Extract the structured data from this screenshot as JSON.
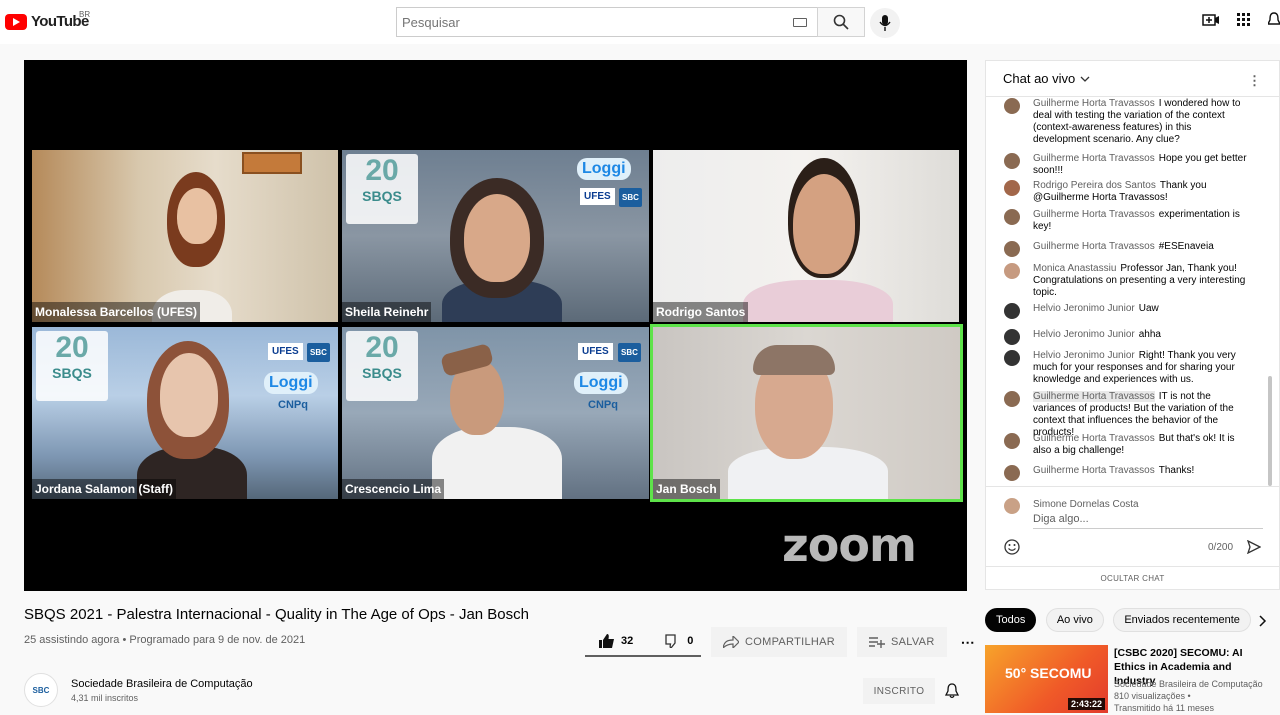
{
  "header": {
    "logo_text": "YouTube",
    "country": "BR",
    "search_placeholder": "Pesquisar"
  },
  "video": {
    "zoom_text": "zoom",
    "participants": [
      {
        "name": "Monalessa Barcellos (UFES)"
      },
      {
        "name": "Sheila Reinehr"
      },
      {
        "name": "Rodrigo Santos"
      },
      {
        "name": "Jordana Salamon (Staff)"
      },
      {
        "name": "Crescencio Lima"
      },
      {
        "name": "Jan Bosch"
      }
    ],
    "event_logo": "SBQS",
    "event_years": "20",
    "sponsor": "Loggi",
    "ufes": "UFES",
    "sbc": "SBC",
    "cnpq": "CNPq"
  },
  "info": {
    "title": "SBQS 2021 - Palestra Internacional - Quality in The Age of Ops - Jan Bosch",
    "meta": "25 assistindo agora • Programado para 9 de nov. de 2021",
    "likes": "32",
    "dislikes": "0",
    "share": "COMPARTILHAR",
    "save": "SALVAR",
    "channel": "Sociedade Brasileira de Computação",
    "subs": "4,31 mil inscritos",
    "subscribe": "INSCRITO"
  },
  "chat": {
    "title": "Chat ao vivo",
    "messages": [
      {
        "author": "Guilherme Horta Travassos",
        "text": "I wondered how to deal with testing the variation of the context (context-awareness features) in this development scenario. Any clue?"
      },
      {
        "author": "Guilherme Horta Travassos",
        "text": "Hope you get better soon!!!"
      },
      {
        "author": "Rodrigo Pereira dos Santos",
        "text": "Thank you @Guilherme Horta Travassos!"
      },
      {
        "author": "Guilherme Horta Travassos",
        "text": "experimentation is key!"
      },
      {
        "author": "Guilherme Horta Travassos",
        "text": "#ESEnaveia"
      },
      {
        "author": "Monica Anastassiu",
        "text": "Professor Jan, Thank you! Congratulations on presenting a very interesting topic."
      },
      {
        "author": "Helvio Jeronimo Junior",
        "text": "Uaw"
      },
      {
        "author": "Helvio Jeronimo Junior",
        "text": "ahha"
      },
      {
        "author": "Helvio Jeronimo Junior",
        "text": "Right! Thank you very much for your responses and for sharing your knowledge and experiences with us."
      },
      {
        "author": "Guilherme Horta Travassos",
        "text": "IT is not the variances of products! But the variation of the context that influences the behavior of the products!"
      },
      {
        "author": "Guilherme Horta Travassos",
        "text": "But that's ok! It is also a big challenge!"
      },
      {
        "author": "Guilherme Horta Travassos",
        "text": "Thanks!"
      }
    ],
    "input_user": "Simone Dornelas Costa",
    "input_placeholder": "Diga algo...",
    "counter": "0/200",
    "hide": "OCULTAR CHAT"
  },
  "chips": [
    "Todos",
    "Ao vivo",
    "Enviados recentemente"
  ],
  "related": {
    "title": "[CSBC 2020] SECOMU: AI Ethics in Academia and Industry",
    "channel": "Sociedade Brasileira de Computação",
    "views": "810 visualizações •",
    "time": "Transmitido há 11 meses",
    "duration": "2:43:22",
    "thumb_text": "50° SECOMU"
  }
}
